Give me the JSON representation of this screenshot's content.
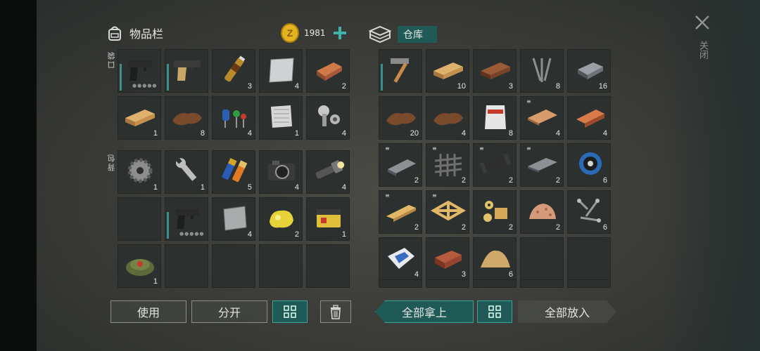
{
  "inventory": {
    "title": "物品栏",
    "coins": "1981",
    "pocket_label": "口袋",
    "backpack_label": "背包"
  },
  "storage": {
    "title": "仓库"
  },
  "close": {
    "label": "关闭"
  },
  "buttons": {
    "use": "使用",
    "split": "分开",
    "take_all": "全部拿上",
    "put_all": "全部放入"
  },
  "colors": {
    "accent": "#3aa39d",
    "panel": "#2c302f",
    "coin": "#e3b320"
  },
  "pocket": [
    {
      "icon": "pistol-icon",
      "qty": ""
    },
    {
      "icon": "desert-eagle-icon",
      "qty": ""
    },
    {
      "icon": "vial-icon",
      "qty": "3"
    },
    {
      "icon": "metal-plate-icon",
      "qty": "4"
    },
    {
      "icon": "copper-bar-icon",
      "qty": "2"
    },
    {
      "icon": "wood-plank-icon",
      "qty": "1"
    },
    {
      "icon": "leather-icon",
      "qty": "8"
    },
    {
      "icon": "electronic-parts-icon",
      "qty": "4"
    },
    {
      "icon": "fabric-icon",
      "qty": "1"
    },
    {
      "icon": "scrap-parts-icon",
      "qty": "4"
    }
  ],
  "backpack": [
    {
      "icon": "gear-icon",
      "qty": "1"
    },
    {
      "icon": "wrench-icon",
      "qty": "1"
    },
    {
      "icon": "batteries-icon",
      "qty": "5"
    },
    {
      "icon": "camera-icon",
      "qty": "4"
    },
    {
      "icon": "flashlight-icon",
      "qty": "4"
    },
    {
      "icon": "",
      "qty": ""
    },
    {
      "icon": "pistol-icon",
      "qty": ""
    },
    {
      "icon": "metal-sheet-icon",
      "qty": "4"
    },
    {
      "icon": "gold-nugget-icon",
      "qty": "2"
    },
    {
      "icon": "car-battery-icon",
      "qty": "1"
    },
    {
      "icon": "landmine-icon",
      "qty": "1"
    },
    {
      "icon": "",
      "qty": ""
    },
    {
      "icon": "",
      "qty": ""
    },
    {
      "icon": "",
      "qty": ""
    },
    {
      "icon": "",
      "qty": ""
    }
  ],
  "storage_items": [
    {
      "icon": "hammer-icon",
      "qty": ""
    },
    {
      "icon": "wood-plank-icon",
      "qty": "10"
    },
    {
      "icon": "wood-plank-dark-icon",
      "qty": "3"
    },
    {
      "icon": "nails-icon",
      "qty": "8"
    },
    {
      "icon": "steel-ingot-icon",
      "qty": "16"
    },
    {
      "icon": "leather-icon",
      "qty": "20"
    },
    {
      "icon": "leather-icon",
      "qty": "4"
    },
    {
      "icon": "asbestos-bag-icon",
      "qty": "8"
    },
    {
      "icon": "board-icon",
      "qty": "4"
    },
    {
      "icon": "copper-ingot-icon",
      "qty": "4"
    },
    {
      "icon": "steel-beam-icon",
      "qty": "2"
    },
    {
      "icon": "rebar-mesh-icon",
      "qty": "2"
    },
    {
      "icon": "pipe-icon",
      "qty": "2"
    },
    {
      "icon": "steel-plate-icon",
      "qty": "2"
    },
    {
      "icon": "wire-spool-icon",
      "qty": "6"
    },
    {
      "icon": "timber-beam-icon",
      "qty": "2"
    },
    {
      "icon": "wood-frame-icon",
      "qty": "2"
    },
    {
      "icon": "bolts-nuts-icon",
      "qty": "2"
    },
    {
      "icon": "wood-chips-icon",
      "qty": "2"
    },
    {
      "icon": "screws-icon",
      "qty": "6"
    },
    {
      "icon": "cement-bag-icon",
      "qty": "4"
    },
    {
      "icon": "brick-icon",
      "qty": "3"
    },
    {
      "icon": "sand-pile-icon",
      "qty": "6"
    },
    {
      "icon": "",
      "qty": ""
    },
    {
      "icon": "",
      "qty": ""
    }
  ]
}
